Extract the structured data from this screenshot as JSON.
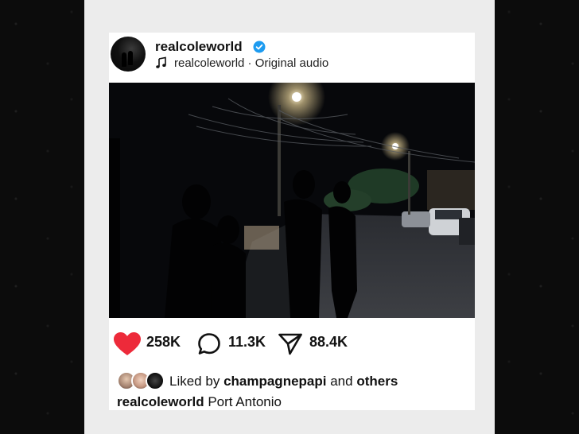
{
  "post": {
    "username": "realcoleworld",
    "verified": true,
    "audio_label": "realcoleworld · Original audio",
    "media_alt": "Night street scene with silhouetted people walking under a street light"
  },
  "actions": {
    "likes": "258K",
    "comments": "11.3K",
    "shares": "88.4K"
  },
  "liked_by": {
    "prefix": "Liked by",
    "user": "champagnepapi",
    "connector": "and",
    "others": "others"
  },
  "caption": {
    "username": "realcoleworld",
    "text": "Port Antonio"
  },
  "colors": {
    "heart": "#ed2a3a",
    "verified": "#1d9bf0",
    "card": "#ffffff",
    "frame": "#ececec",
    "background": "#0c0c0c"
  },
  "icons": [
    "verified-badge-icon",
    "music-note-icon",
    "heart-icon",
    "comment-icon",
    "share-icon"
  ]
}
